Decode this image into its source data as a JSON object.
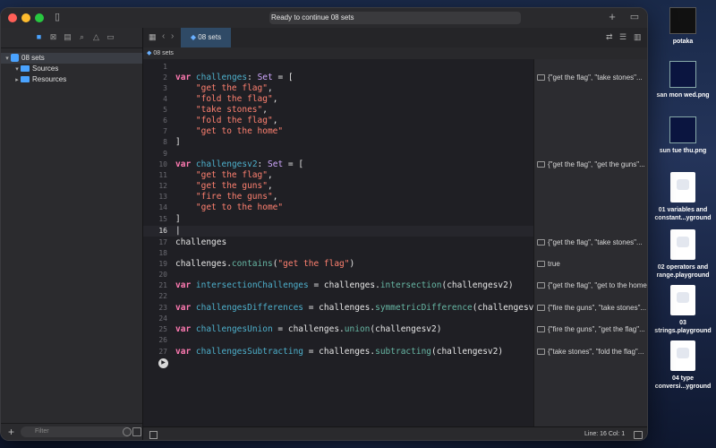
{
  "window": {
    "status_text": "Ready to continue 08 sets",
    "tab_title": "08 sets",
    "breadcrumb": "08 sets"
  },
  "sidebar": {
    "items": [
      {
        "label": "08 sets",
        "level": 0,
        "expanded": true
      },
      {
        "label": "Sources",
        "level": 1,
        "expanded": true
      },
      {
        "label": "Resources",
        "level": 1,
        "expanded": false
      }
    ],
    "filter_placeholder": "Filter"
  },
  "editor": {
    "line_numbers": [
      "1",
      "2",
      "3",
      "4",
      "5",
      "6",
      "7",
      "8",
      "9",
      "10",
      "11",
      "12",
      "13",
      "14",
      "15",
      "16",
      "17",
      "18",
      "19",
      "20",
      "21",
      "22",
      "23",
      "24",
      "25",
      "26",
      "27"
    ],
    "current_line": 16
  },
  "results": [
    "{\"get the flag\", \"take stones\"...",
    "{\"get the flag\", \"get the guns\"...",
    "{\"get the flag\", \"take stones\"...",
    "true",
    "{\"get the flag\", \"get to the home\"...",
    "{\"fire the guns\", \"take stones\"...",
    "{\"fire the guns\", \"get the flag\"...",
    "{\"take stones\", \"fold the flag\"..."
  ],
  "statusbar": {
    "position": "Line: 16  Col: 1"
  },
  "desktop": [
    {
      "label": "potaka"
    },
    {
      "label": "san mon wed.png"
    },
    {
      "label": "sun tue thu.png"
    },
    {
      "label": "01 variables and constant...yground"
    },
    {
      "label": "02 operators and range.playground"
    },
    {
      "label": "03 strings.playground"
    },
    {
      "label": "04 type conversi...yground"
    }
  ],
  "colors": {
    "accent": "#4aa3ff",
    "keyword": "#ff7ab2",
    "string": "#ff8170",
    "type": "#d0a8ff",
    "method": "#67b7a4"
  }
}
